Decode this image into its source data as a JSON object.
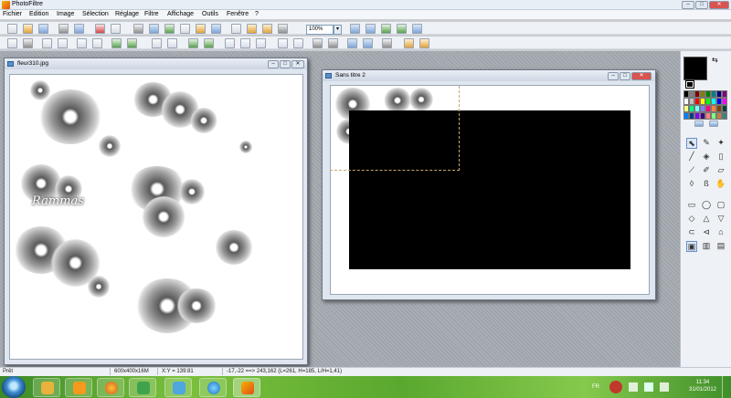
{
  "app": {
    "title": "PhotoFiltre"
  },
  "menu": [
    "Fichier",
    "Edition",
    "Image",
    "Sélection",
    "Réglage",
    "Filtre",
    "Affichage",
    "Outils",
    "Fenêtre",
    "?"
  ],
  "toolbar": {
    "zoom": "100%"
  },
  "documents": [
    {
      "title": "fleur310.jpg",
      "signature": "Rammas"
    },
    {
      "title": "Sans titre 2"
    }
  ],
  "colors": {
    "foreground": "#000000"
  },
  "palette": [
    "#000000",
    "#808080",
    "#800000",
    "#808000",
    "#008000",
    "#008080",
    "#000080",
    "#800080",
    "#ffffff",
    "#c0c0c0",
    "#ff0000",
    "#ffff00",
    "#00ff00",
    "#00ffff",
    "#0000ff",
    "#ff00ff",
    "#ffff80",
    "#00ff80",
    "#80ffff",
    "#8080ff",
    "#ff0080",
    "#ff8040",
    "#804000",
    "#004040",
    "#0080ff",
    "#004080",
    "#8000ff",
    "#400080",
    "#ff8080",
    "#80ff80",
    "#c08040",
    "#408080"
  ],
  "status": {
    "state": "Prêt",
    "size": "600x400x16M",
    "xy": "X:Y = 139:81",
    "selection": "-17,-22 ==> 243,162 (L=261, H=185, L/H=1,41)"
  },
  "taskbar": {
    "lang": "FR",
    "time": "11:34",
    "date": "31/01/2012"
  }
}
